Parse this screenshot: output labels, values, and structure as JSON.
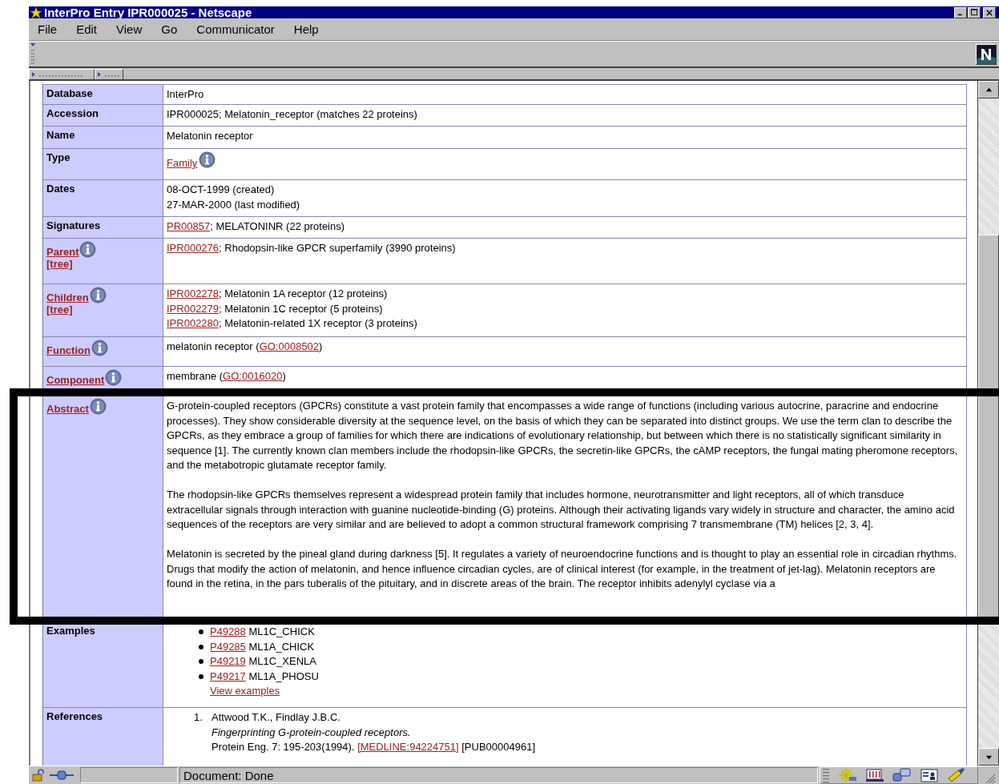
{
  "window": {
    "title": "InterPro Entry IPR000025 - Netscape"
  },
  "menu": [
    {
      "label": "File"
    },
    {
      "label": "Edit"
    },
    {
      "label": "View"
    },
    {
      "label": "Go"
    },
    {
      "label": "Communicator"
    },
    {
      "label": "Help"
    }
  ],
  "rows": [
    {
      "label": "Database",
      "kind": "lines",
      "label_link": false,
      "info": false,
      "lines": [
        [
          {
            "t": "InterPro",
            "link": false
          }
        ]
      ]
    },
    {
      "label": "Accession",
      "kind": "lines",
      "label_link": false,
      "info": false,
      "lines": [
        [
          {
            "t": "IPR000025; Melatonin_receptor (matches 22 proteins)",
            "link": false
          }
        ]
      ]
    },
    {
      "label": "Name",
      "kind": "lines",
      "label_link": false,
      "info": false,
      "lines": [
        [
          {
            "t": "Melatonin receptor",
            "link": false
          }
        ]
      ]
    },
    {
      "label": "Type",
      "kind": "lines",
      "label_link": false,
      "info": false,
      "lines": [
        [
          {
            "t": "Family",
            "link": true
          }
        ]
      ],
      "value_info": true
    },
    {
      "label": "Dates",
      "kind": "lines",
      "label_link": false,
      "info": false,
      "lines": [
        [
          {
            "t": "08-OCT-1999 (created)",
            "link": false
          }
        ],
        [
          {
            "t": "27-MAR-2000 (last modified)",
            "link": false
          }
        ]
      ]
    },
    {
      "label": "Signatures",
      "kind": "lines",
      "label_link": false,
      "info": false,
      "lines": [
        [
          {
            "t": "PR00857",
            "link": true
          },
          {
            "t": "; MELATONINR (22 proteins)",
            "link": false
          }
        ]
      ]
    },
    {
      "label": "Parent",
      "kind": "lines",
      "label_link": true,
      "info": true,
      "tree": "[tree]",
      "lines": [
        [
          {
            "t": "IPR000276",
            "link": true
          },
          {
            "t": "; Rhodopsin-like GPCR superfamily (3990 proteins)",
            "link": false
          }
        ]
      ]
    },
    {
      "label": "Children",
      "kind": "lines",
      "label_link": true,
      "info": true,
      "tree": "[tree]",
      "lines": [
        [
          {
            "t": "IPR002278",
            "link": true
          },
          {
            "t": "; Melatonin 1A receptor (12 proteins)",
            "link": false
          }
        ],
        [
          {
            "t": "IPR002279",
            "link": true
          },
          {
            "t": "; Melatonin 1C receptor (5 proteins)",
            "link": false
          }
        ],
        [
          {
            "t": "IPR002280",
            "link": true
          },
          {
            "t": "; Melatonin-related 1X receptor (3 proteins)",
            "link": false
          }
        ]
      ]
    },
    {
      "label": "Function",
      "kind": "lines",
      "label_link": true,
      "info": true,
      "lines": [
        [
          {
            "t": "melatonin receptor (",
            "link": false
          },
          {
            "t": "GO:0008502",
            "link": true
          },
          {
            "t": ")",
            "link": false
          }
        ]
      ]
    },
    {
      "label": "Component",
      "kind": "lines",
      "label_link": true,
      "info": true,
      "lines": [
        [
          {
            "t": "membrane (",
            "link": false
          },
          {
            "t": "GO:0016020",
            "link": true
          },
          {
            "t": ")",
            "link": false
          }
        ]
      ]
    },
    {
      "label": "Abstract",
      "kind": "paragraphs",
      "label_link": true,
      "info": true,
      "paragraphs": [
        "G-protein-coupled receptors (GPCRs) constitute a vast protein family that encompasses a wide range of functions (including various autocrine, paracrine and endocrine processes). They show considerable diversity at the sequence level, on the basis of which they can be separated into distinct groups. We use the term clan to describe the GPCRs, as they embrace a group of families for which there are indications of evolutionary relationship, but between which there is no statistically significant similarity in sequence [1]. The currently known clan members include the rhodopsin-like GPCRs, the secretin-like GPCRs, the cAMP receptors, the fungal mating pheromone receptors, and the metabotropic glutamate receptor family.",
        "The rhodopsin-like GPCRs themselves represent a widespread protein family that includes hormone, neurotransmitter and light receptors, all of which transduce extracellular signals through interaction with guanine nucleotide-binding (G) proteins. Although their activating ligands vary widely in structure and character, the amino acid sequences of the receptors are very similar and are believed to adopt a common structural framework comprising 7 transmembrane (TM) helices [2, 3, 4].",
        "Melatonin is secreted by the pineal gland during darkness [5]. It regulates a variety of neuroendocrine functions and is thought to play an essential role in circadian rhythms. Drugs that modify the action of melatonin, and hence influence circadian cycles, are of clinical interest (for example, in the treatment of jet-lag). Melatonin receptors are found in the retina, in the pars tuberalis of the pituitary, and in discrete areas of the brain. The receptor inhibits adenylyl cyclase via a"
      ]
    },
    {
      "label": "Examples",
      "kind": "bullets",
      "label_link": false,
      "info": false,
      "items": [
        {
          "id": "P49288",
          "name": "ML1C_CHICK"
        },
        {
          "id": "P49285",
          "name": "ML1A_CHICK"
        },
        {
          "id": "P49219",
          "name": "ML1C_XENLA"
        },
        {
          "id": "P49217",
          "name": "ML1A_PHOSU"
        }
      ],
      "more": "View examples"
    },
    {
      "label": "References",
      "kind": "references",
      "label_link": false,
      "info": false,
      "refs": [
        {
          "num": "1.",
          "authors": "Attwood T.K., Findlay J.B.C.",
          "title": "Fingerprinting G-protein-coupled receptors.",
          "citation": "Protein Eng. 7: 195-203(1994).",
          "medline": "[MEDLINE:94224751]",
          "pub": "[PUB00004961]"
        }
      ]
    }
  ],
  "status_bar": {
    "text": "Document: Done"
  }
}
